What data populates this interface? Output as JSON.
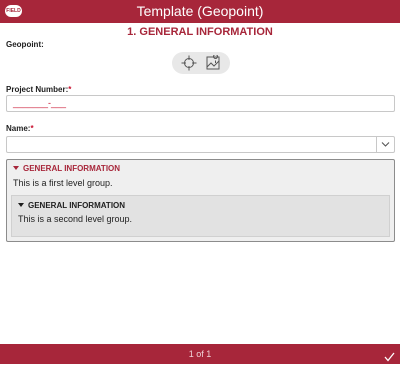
{
  "app": {
    "title": "Template (Geopoint)",
    "logo_text": "FIELD"
  },
  "section": {
    "title": "1. GENERAL INFORMATION"
  },
  "fields": {
    "geopoint": {
      "label": "Geopoint:",
      "locate_icon": "crosshair-icon",
      "map_icon": "map-pin-icon"
    },
    "project_number": {
      "label": "Project Number:",
      "required_mark": "*",
      "mask": "_______-___"
    },
    "name": {
      "label": "Name:",
      "required_mark": "*",
      "value": "",
      "dropdown_icon": "chevron-down-icon"
    }
  },
  "groups": {
    "first": {
      "title": "GENERAL INFORMATION",
      "text": "This is a first level group."
    },
    "second": {
      "title": "GENERAL INFORMATION",
      "text": "This is a second level group."
    }
  },
  "footer": {
    "page": "1 of 1",
    "submit_icon": "check-icon"
  },
  "colors": {
    "brand": "#a7263a",
    "required": "#c8102e",
    "group_bg": "#efefef"
  }
}
